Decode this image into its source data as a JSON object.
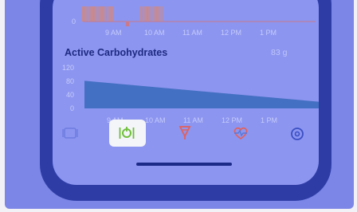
{
  "top_chart": {
    "y_tick": "0",
    "x_ticks": [
      "9 AM",
      "10 AM",
      "11 AM",
      "12 PM",
      "1 PM"
    ]
  },
  "carbs": {
    "title": "Active Carbohydrates",
    "current_value": "83 g"
  },
  "chart_data": {
    "type": "area",
    "title": "Active Carbohydrates",
    "y_ticks": [
      "120",
      "80",
      "40",
      "0"
    ],
    "x_ticks": [
      "9 AM",
      "10 AM",
      "11 AM",
      "12 PM",
      "1 PM"
    ],
    "ylim": [
      0,
      120
    ],
    "x": [
      "8:30 AM",
      "1:30 PM"
    ],
    "values": [
      83,
      20
    ]
  },
  "colors": {
    "accent_green": "#6fbf3a",
    "heart_red": "#e3605a",
    "heart_blue": "#5a78d6",
    "bar_fill": "#c88a90"
  },
  "tabs": [
    {
      "icon": "plate-icon",
      "active": false
    },
    {
      "icon": "carb-entry-icon",
      "active": true
    },
    {
      "icon": "bolus-icon",
      "active": false
    },
    {
      "icon": "heart-icon",
      "active": false
    },
    {
      "icon": "settings-icon",
      "active": false
    }
  ]
}
